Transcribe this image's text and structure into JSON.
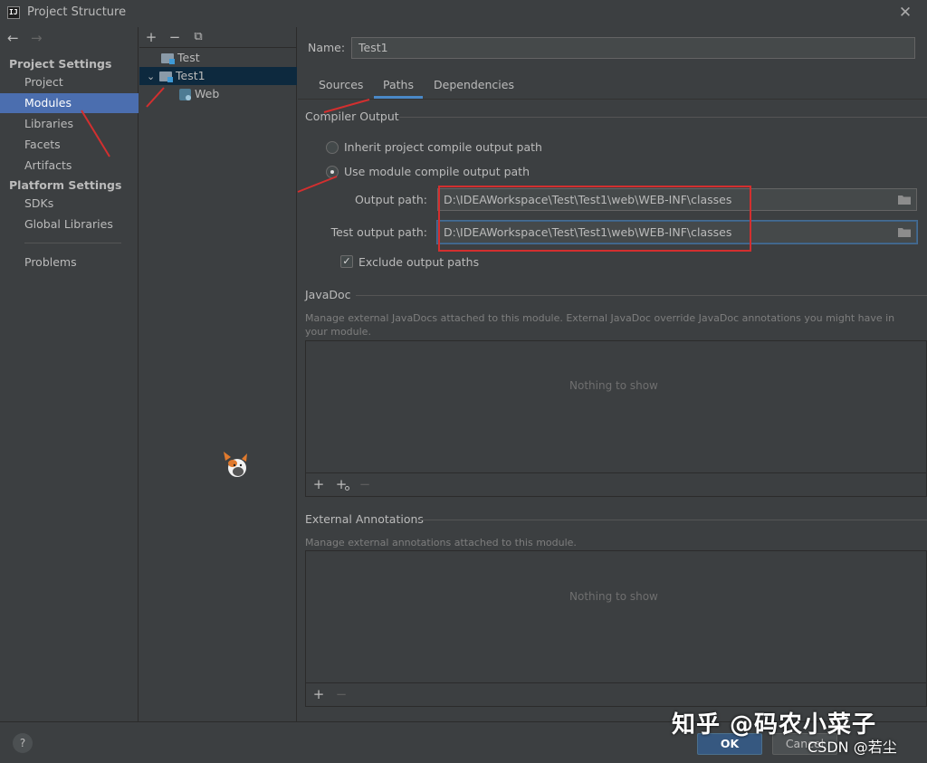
{
  "window": {
    "title": "Project Structure",
    "logo_text": "IJ",
    "close_glyph": "✕"
  },
  "nav": {
    "back_glyph": "←",
    "forward_glyph": "→",
    "project_settings_heading": "Project Settings",
    "project_items": [
      "Project",
      "Modules",
      "Libraries",
      "Facets",
      "Artifacts"
    ],
    "selected": "Modules",
    "platform_settings_heading": "Platform Settings",
    "platform_items": [
      "SDKs",
      "Global Libraries"
    ],
    "problems": "Problems"
  },
  "tree": {
    "toolbar": {
      "add": "+",
      "remove": "−",
      "copy": "⧉"
    },
    "items": [
      {
        "label": "Test",
        "icon": "module-folder-icon"
      },
      {
        "label": "Test1",
        "icon": "module-folder-icon",
        "expanded": true,
        "selected": true
      },
      {
        "label": "Web",
        "icon": "web-facet-icon"
      }
    ],
    "expand_glyph": "⌄"
  },
  "module": {
    "name_label": "Name:",
    "name_value": "Test1",
    "tabs": [
      "Sources",
      "Paths",
      "Dependencies"
    ],
    "active_tab": "Paths",
    "compiler_output": {
      "title": "Compiler Output",
      "inherit_label": "Inherit project compile output path",
      "use_module_label": "Use module compile output path",
      "selected_option": "use_module",
      "output_label": "Output path:",
      "output_value": "D:\\IDEAWorkspace\\Test\\Test1\\web\\WEB-INF\\classes",
      "test_output_label": "Test output path:",
      "test_output_value": "D:\\IDEAWorkspace\\Test\\Test1\\web\\WEB-INF\\classes",
      "exclude_label": "Exclude output paths",
      "exclude_checked": true
    },
    "javadoc": {
      "title": "JavaDoc",
      "description": "Manage external JavaDocs attached to this module. External JavaDoc override JavaDoc annotations you might have in your module.",
      "empty_text": "Nothing to show",
      "toolbar": {
        "add": "+",
        "add_url": "+",
        "remove": "−"
      }
    },
    "external_annotations": {
      "title": "External Annotations",
      "description": "Manage external annotations attached to this module.",
      "empty_text": "Nothing to show",
      "toolbar": {
        "add": "+",
        "remove": "−"
      }
    }
  },
  "footer": {
    "help": "?",
    "ok": "OK",
    "cancel": "Cancel"
  },
  "watermark": {
    "line1": "知乎 @码农小菜子",
    "line2": "CSDN @若尘"
  },
  "colors": {
    "background": "#3c3f41",
    "selection": "#4b6eaf",
    "tree_selection": "#0d293e",
    "tab_underline": "#4a88c7",
    "ok_button": "#365880",
    "annotation_red": "#d32f2f"
  }
}
